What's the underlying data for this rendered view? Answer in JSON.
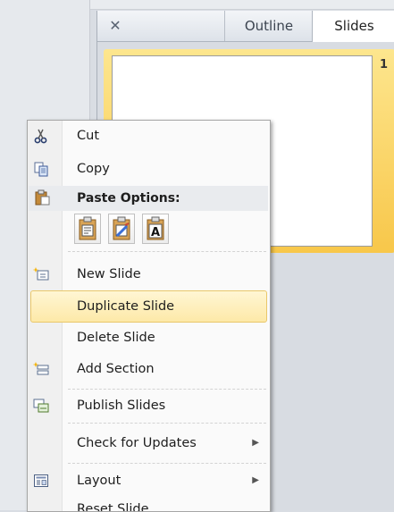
{
  "panel": {
    "tabs": [
      {
        "label": "Outline",
        "active": false
      },
      {
        "label": "Slides",
        "active": true
      }
    ],
    "slide_number": "1"
  },
  "context_menu": {
    "items": {
      "cut": {
        "label": "Cut",
        "icon": "scissors-icon"
      },
      "copy": {
        "label": "Copy",
        "icon": "copy-icon"
      },
      "paste_options": {
        "label": "Paste Options:",
        "icon": "clipboard-icon"
      },
      "paste_buttons": [
        {
          "icon": "paste-use-destination-theme-icon"
        },
        {
          "icon": "paste-keep-source-formatting-icon"
        },
        {
          "icon": "paste-keep-text-only-icon",
          "glyph": "A"
        }
      ],
      "new_slide": {
        "label": "New Slide",
        "icon": "new-slide-icon"
      },
      "duplicate_slide": {
        "label": "Duplicate Slide",
        "highlighted": true
      },
      "delete_slide": {
        "label": "Delete Slide"
      },
      "add_section": {
        "label": "Add Section",
        "icon": "add-section-icon"
      },
      "publish_slides": {
        "label": "Publish Slides",
        "icon": "publish-slides-icon"
      },
      "check_for_updates": {
        "label": "Check for Updates",
        "has_submenu": true
      },
      "layout": {
        "label": "Layout",
        "icon": "layout-icon",
        "has_submenu": true
      },
      "reset_slide": {
        "label": "Reset Slide"
      }
    }
  },
  "colors": {
    "selection_yellow": "#f8c74a",
    "highlight_border": "#e9c76a"
  }
}
